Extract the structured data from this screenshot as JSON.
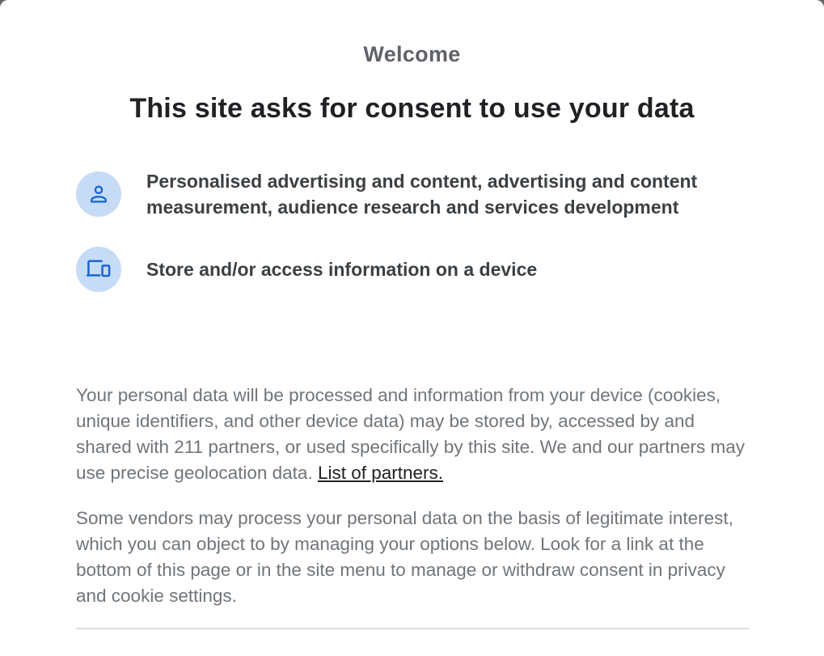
{
  "dialog": {
    "welcome": "Welcome",
    "title": "This site asks for consent to use your data",
    "purposes": [
      {
        "icon": "person-icon",
        "label": "Personalised advertising and content, advertising and content measurement, audience research and services development"
      },
      {
        "icon": "devices-icon",
        "label": "Store and/or access information on a device"
      }
    ],
    "paragraph1_text": "Your personal data will be processed and information from your device (cookies, unique identifiers, and other device data) may be stored by, accessed by and shared with 211 partners, or used specifically by this site. We and our partners may use precise geolocation data. ",
    "partners_link": "List of partners.",
    "paragraph2_text": "Some vendors may process your personal data on the basis of legitimate interest, which you can object to by managing your options below. Look for a link at the bottom of this page or in the site menu to manage or withdraw consent in privacy and cookie settings."
  },
  "colors": {
    "icon_bg": "#c6dbf6",
    "icon_fg": "#1a66d2",
    "title": "#202124",
    "body_text": "#70757a"
  }
}
